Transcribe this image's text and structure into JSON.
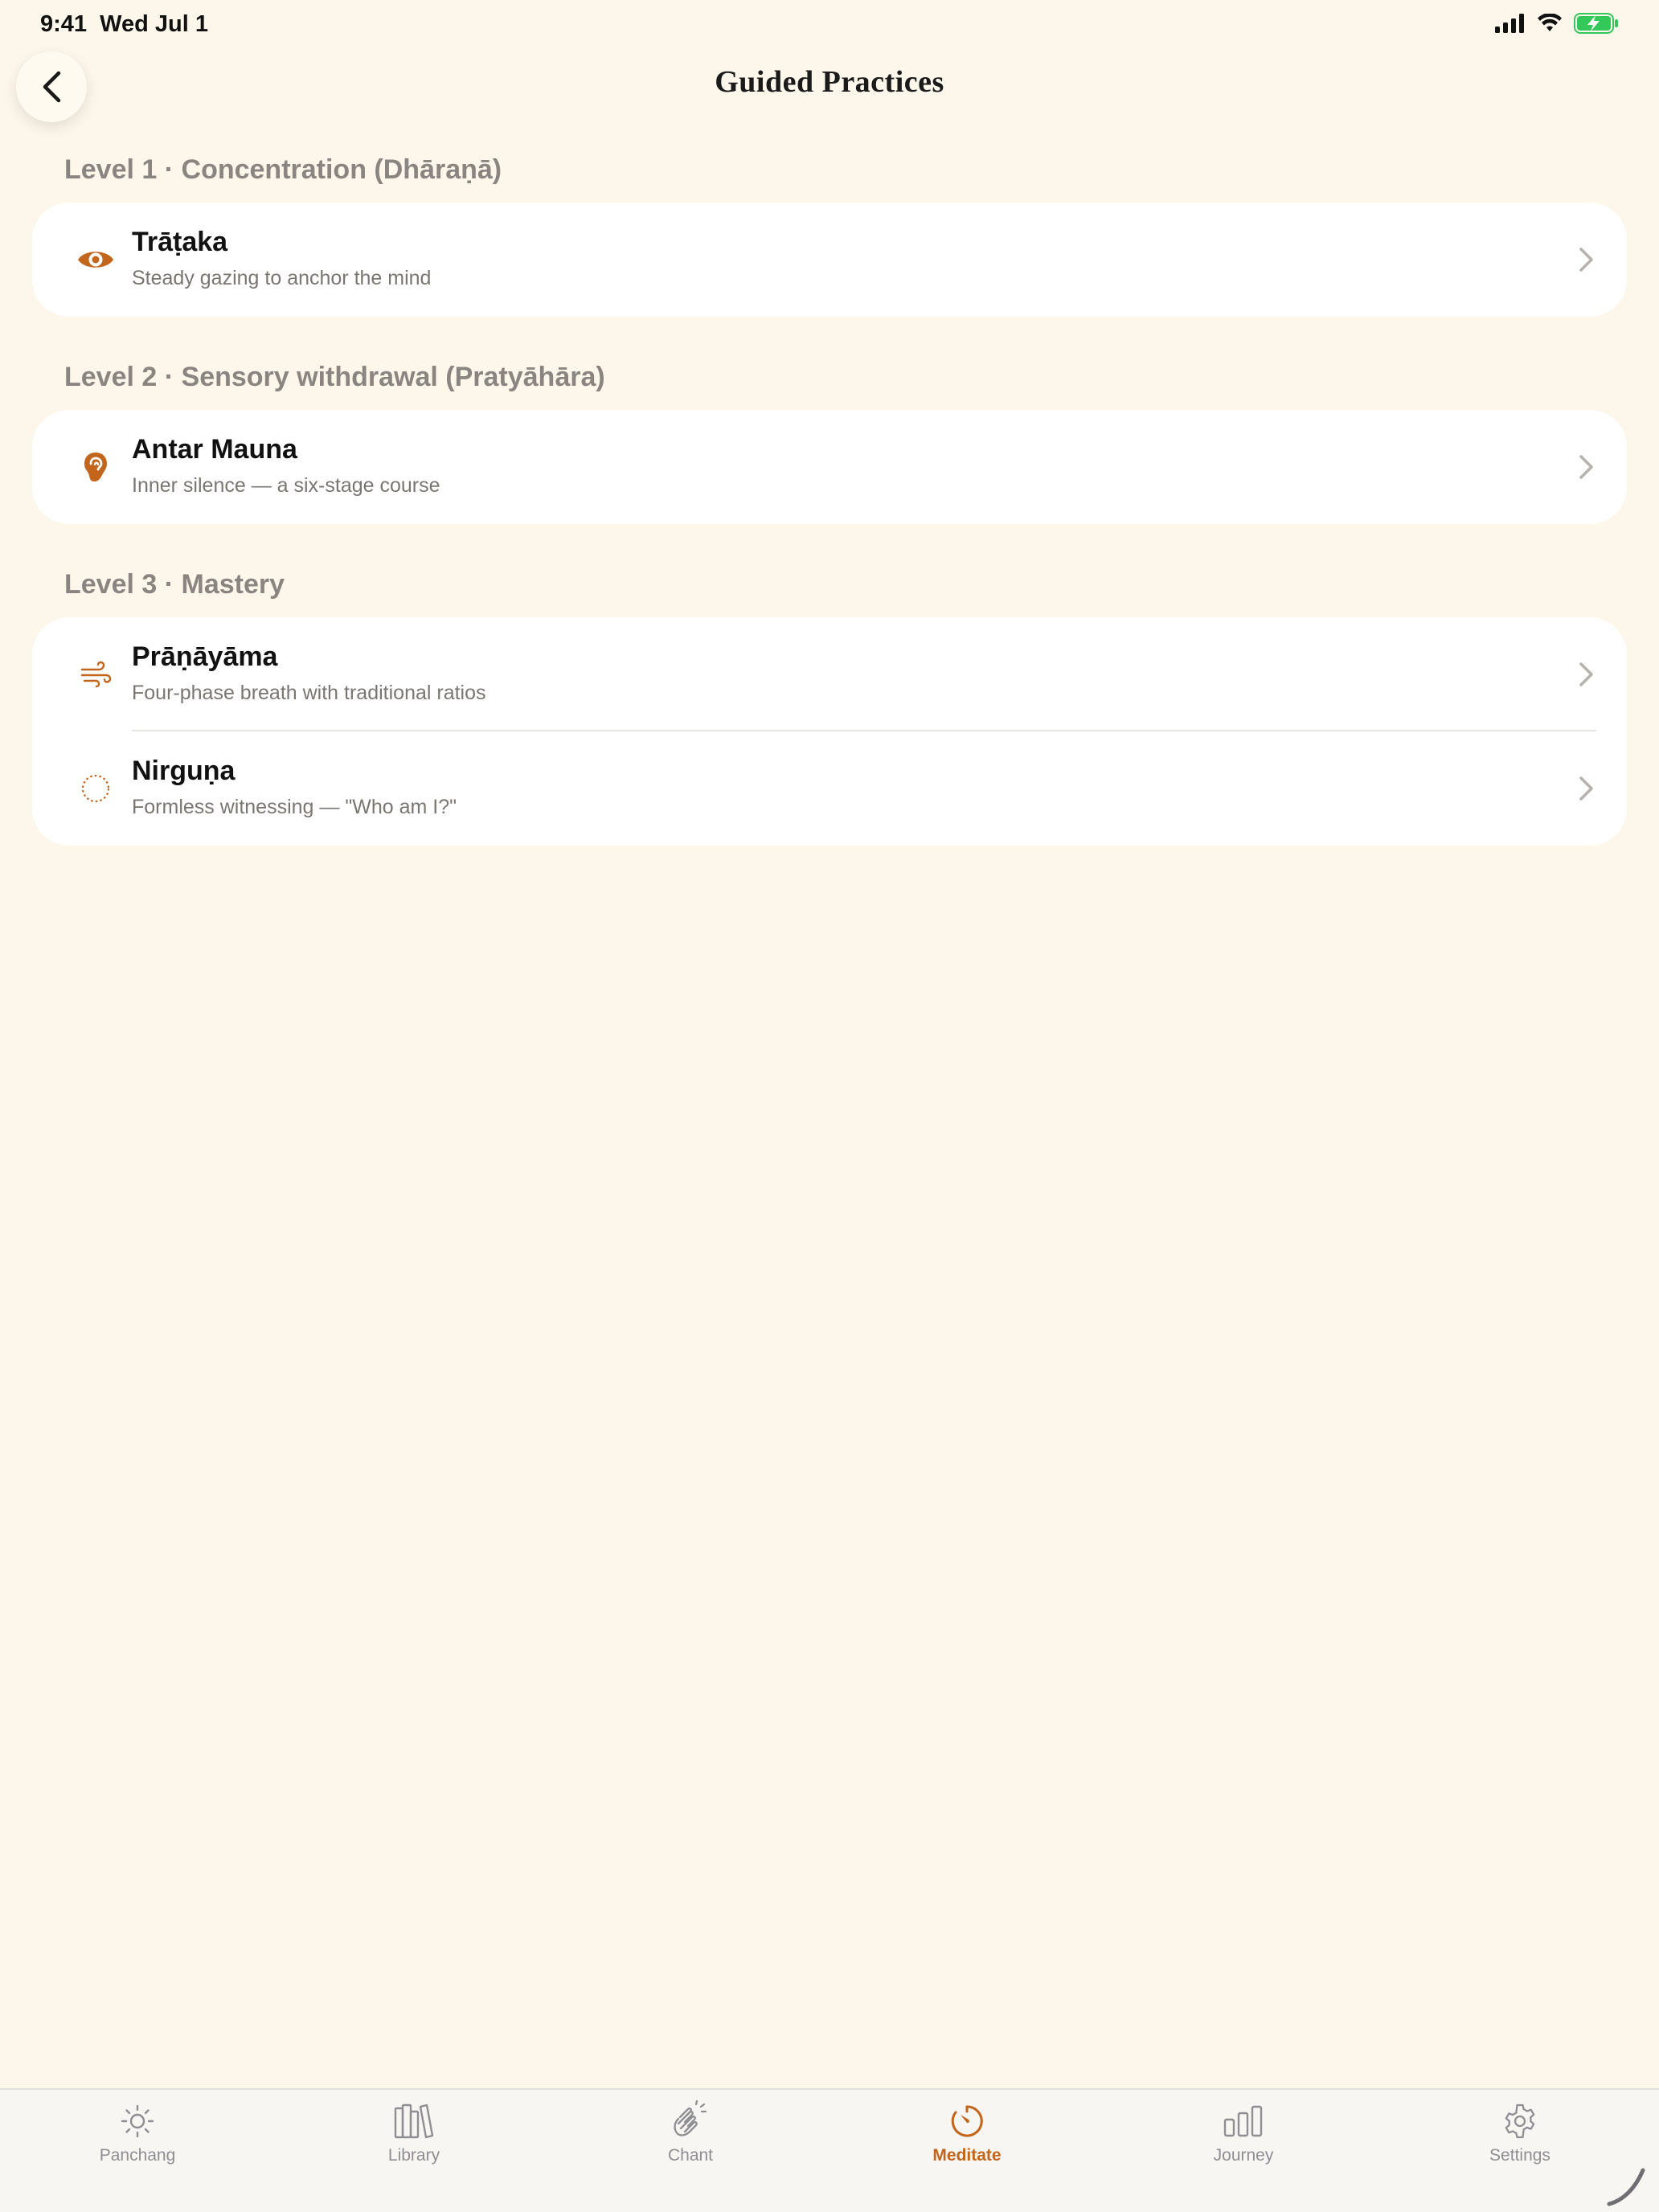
{
  "status": {
    "time": "9:41",
    "date": "Wed Jul 1"
  },
  "nav": {
    "title": "Guided Practices"
  },
  "sections": [
    {
      "header": "Level 1 · Concentration (Dhāraṇā)",
      "items": [
        {
          "icon": "eye-icon",
          "title": "Trāṭaka",
          "subtitle": "Steady gazing to anchor the mind"
        }
      ]
    },
    {
      "header": "Level 2 · Sensory withdrawal (Pratyāhāra)",
      "items": [
        {
          "icon": "ear-icon",
          "title": "Antar Mauna",
          "subtitle": "Inner silence — a six-stage course"
        }
      ]
    },
    {
      "header": "Level 3 · Mastery",
      "items": [
        {
          "icon": "wind-icon",
          "title": "Prāṇāyāma",
          "subtitle": "Four-phase breath with traditional ratios"
        },
        {
          "icon": "dotted-circle-icon",
          "title": "Nirguṇa",
          "subtitle": "Formless witnessing — \"Who am I?\""
        }
      ]
    }
  ],
  "tabs": [
    {
      "label": "Panchang",
      "icon": "sun-icon",
      "active": false
    },
    {
      "label": "Library",
      "icon": "books-icon",
      "active": false
    },
    {
      "label": "Chant",
      "icon": "hands-clap-icon",
      "active": false
    },
    {
      "label": "Meditate",
      "icon": "timer-icon",
      "active": true
    },
    {
      "label": "Journey",
      "icon": "bar-chart-icon",
      "active": false
    },
    {
      "label": "Settings",
      "icon": "gear-icon",
      "active": false
    }
  ],
  "colors": {
    "accent": "#c4651c",
    "background": "#fdf6ea",
    "card": "#ffffff",
    "muted": "#8a8580"
  }
}
